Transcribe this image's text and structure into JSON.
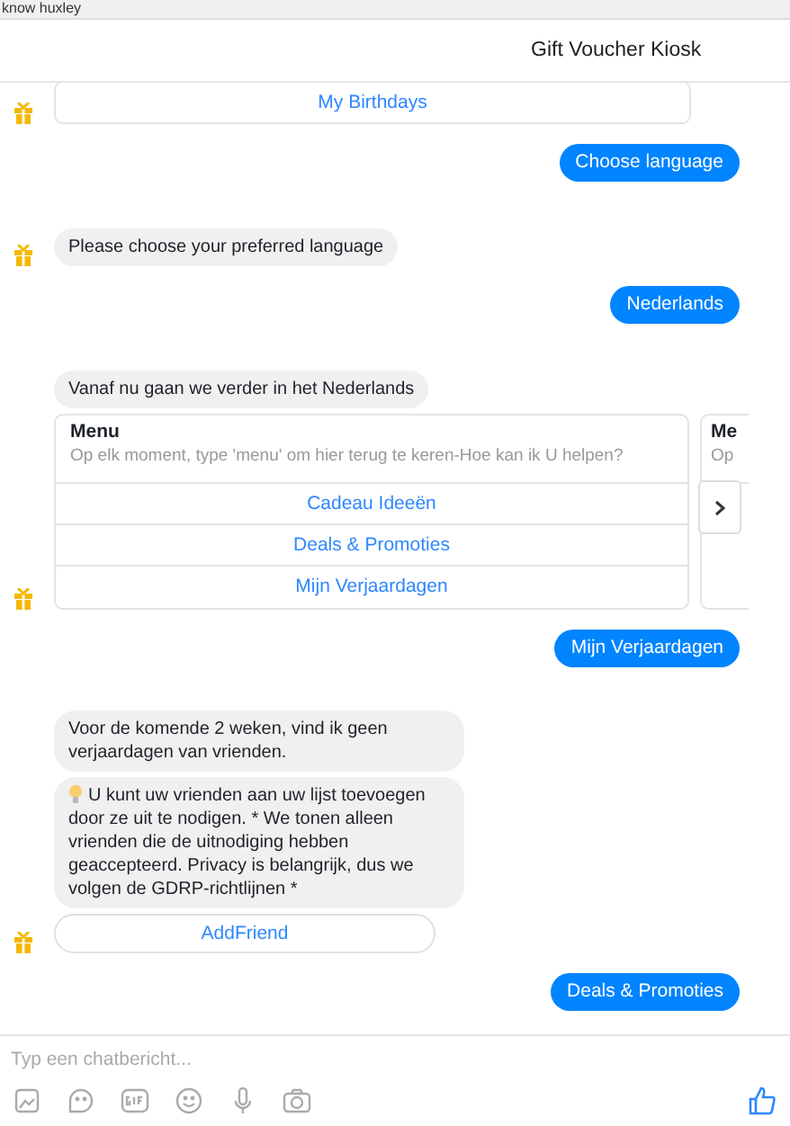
{
  "window": {
    "title": "know huxley"
  },
  "header": {
    "title": "Gift Voucher Kiosk"
  },
  "messages": [
    {
      "kind": "buttons",
      "avatar": true,
      "buttons": [
        "My Birthdays"
      ]
    },
    {
      "kind": "user",
      "text": "Choose language"
    },
    {
      "kind": "bot",
      "avatar": true,
      "bubbles": [
        {
          "text": "Please choose your preferred language",
          "tip": false
        }
      ]
    },
    {
      "kind": "user",
      "text": "Nederlands"
    },
    {
      "kind": "bot",
      "avatar": false,
      "bubbles": [
        {
          "text": "Vanaf nu gaan we verder in het Nederlands",
          "tip": false
        }
      ]
    },
    {
      "kind": "carousel",
      "avatar": true,
      "cards": [
        {
          "title": "Menu",
          "subtitle": "Op elk moment, type 'menu' om hier terug te keren-Hoe kan ik U helpen?",
          "buttons": [
            "Cadeau Ideeën",
            "Deals & Promoties",
            "Mijn Verjaardagen"
          ]
        },
        {
          "title": "Me",
          "subtitle": "Op"
        }
      ]
    },
    {
      "kind": "user",
      "text": "Mijn Verjaardagen"
    },
    {
      "kind": "bot",
      "avatar": true,
      "bubbles": [
        {
          "text": "Voor de komende 2 weken, vind ik geen verjaardagen van vrienden.",
          "tip": false
        },
        {
          "text": "U kunt uw vrienden aan uw lijst toevoegen door ze uit te nodigen. * We tonen alleen vrienden die de uitnodiging hebben geaccepteerd. Privacy is belangrijk, dus we volgen de GDRP-richtlijnen *",
          "tip": true
        }
      ],
      "quick": [
        "AddFriend"
      ]
    },
    {
      "kind": "user",
      "text": "Deals & Promoties"
    }
  ],
  "composer": {
    "placeholder": "Typ een chatbericht..."
  }
}
